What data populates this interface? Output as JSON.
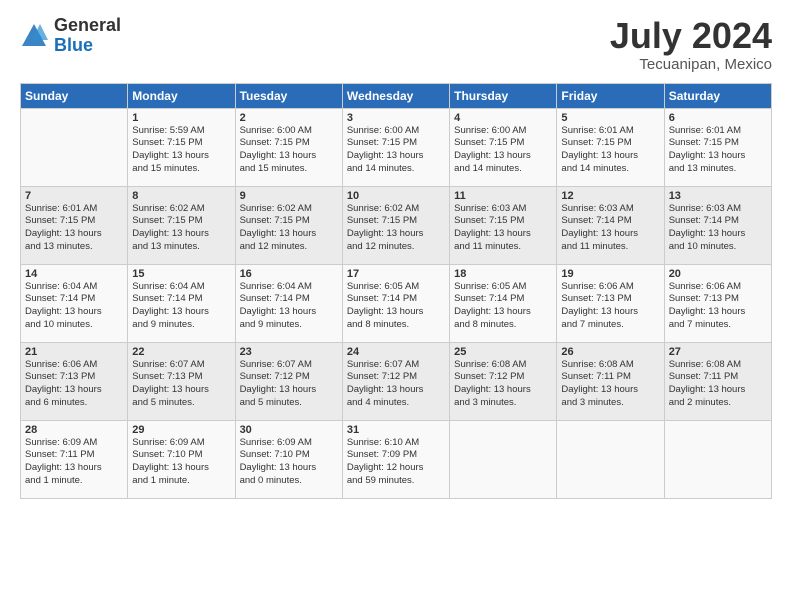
{
  "logo": {
    "general": "General",
    "blue": "Blue"
  },
  "title": "July 2024",
  "location": "Tecuanipan, Mexico",
  "days_of_week": [
    "Sunday",
    "Monday",
    "Tuesday",
    "Wednesday",
    "Thursday",
    "Friday",
    "Saturday"
  ],
  "weeks": [
    [
      {
        "day": "",
        "info": ""
      },
      {
        "day": "1",
        "info": "Sunrise: 5:59 AM\nSunset: 7:15 PM\nDaylight: 13 hours\nand 15 minutes."
      },
      {
        "day": "2",
        "info": "Sunrise: 6:00 AM\nSunset: 7:15 PM\nDaylight: 13 hours\nand 15 minutes."
      },
      {
        "day": "3",
        "info": "Sunrise: 6:00 AM\nSunset: 7:15 PM\nDaylight: 13 hours\nand 14 minutes."
      },
      {
        "day": "4",
        "info": "Sunrise: 6:00 AM\nSunset: 7:15 PM\nDaylight: 13 hours\nand 14 minutes."
      },
      {
        "day": "5",
        "info": "Sunrise: 6:01 AM\nSunset: 7:15 PM\nDaylight: 13 hours\nand 14 minutes."
      },
      {
        "day": "6",
        "info": "Sunrise: 6:01 AM\nSunset: 7:15 PM\nDaylight: 13 hours\nand 13 minutes."
      }
    ],
    [
      {
        "day": "7",
        "info": "Sunrise: 6:01 AM\nSunset: 7:15 PM\nDaylight: 13 hours\nand 13 minutes."
      },
      {
        "day": "8",
        "info": "Sunrise: 6:02 AM\nSunset: 7:15 PM\nDaylight: 13 hours\nand 13 minutes."
      },
      {
        "day": "9",
        "info": "Sunrise: 6:02 AM\nSunset: 7:15 PM\nDaylight: 13 hours\nand 12 minutes."
      },
      {
        "day": "10",
        "info": "Sunrise: 6:02 AM\nSunset: 7:15 PM\nDaylight: 13 hours\nand 12 minutes."
      },
      {
        "day": "11",
        "info": "Sunrise: 6:03 AM\nSunset: 7:15 PM\nDaylight: 13 hours\nand 11 minutes."
      },
      {
        "day": "12",
        "info": "Sunrise: 6:03 AM\nSunset: 7:14 PM\nDaylight: 13 hours\nand 11 minutes."
      },
      {
        "day": "13",
        "info": "Sunrise: 6:03 AM\nSunset: 7:14 PM\nDaylight: 13 hours\nand 10 minutes."
      }
    ],
    [
      {
        "day": "14",
        "info": "Sunrise: 6:04 AM\nSunset: 7:14 PM\nDaylight: 13 hours\nand 10 minutes."
      },
      {
        "day": "15",
        "info": "Sunrise: 6:04 AM\nSunset: 7:14 PM\nDaylight: 13 hours\nand 9 minutes."
      },
      {
        "day": "16",
        "info": "Sunrise: 6:04 AM\nSunset: 7:14 PM\nDaylight: 13 hours\nand 9 minutes."
      },
      {
        "day": "17",
        "info": "Sunrise: 6:05 AM\nSunset: 7:14 PM\nDaylight: 13 hours\nand 8 minutes."
      },
      {
        "day": "18",
        "info": "Sunrise: 6:05 AM\nSunset: 7:14 PM\nDaylight: 13 hours\nand 8 minutes."
      },
      {
        "day": "19",
        "info": "Sunrise: 6:06 AM\nSunset: 7:13 PM\nDaylight: 13 hours\nand 7 minutes."
      },
      {
        "day": "20",
        "info": "Sunrise: 6:06 AM\nSunset: 7:13 PM\nDaylight: 13 hours\nand 7 minutes."
      }
    ],
    [
      {
        "day": "21",
        "info": "Sunrise: 6:06 AM\nSunset: 7:13 PM\nDaylight: 13 hours\nand 6 minutes."
      },
      {
        "day": "22",
        "info": "Sunrise: 6:07 AM\nSunset: 7:13 PM\nDaylight: 13 hours\nand 5 minutes."
      },
      {
        "day": "23",
        "info": "Sunrise: 6:07 AM\nSunset: 7:12 PM\nDaylight: 13 hours\nand 5 minutes."
      },
      {
        "day": "24",
        "info": "Sunrise: 6:07 AM\nSunset: 7:12 PM\nDaylight: 13 hours\nand 4 minutes."
      },
      {
        "day": "25",
        "info": "Sunrise: 6:08 AM\nSunset: 7:12 PM\nDaylight: 13 hours\nand 3 minutes."
      },
      {
        "day": "26",
        "info": "Sunrise: 6:08 AM\nSunset: 7:11 PM\nDaylight: 13 hours\nand 3 minutes."
      },
      {
        "day": "27",
        "info": "Sunrise: 6:08 AM\nSunset: 7:11 PM\nDaylight: 13 hours\nand 2 minutes."
      }
    ],
    [
      {
        "day": "28",
        "info": "Sunrise: 6:09 AM\nSunset: 7:11 PM\nDaylight: 13 hours\nand 1 minute."
      },
      {
        "day": "29",
        "info": "Sunrise: 6:09 AM\nSunset: 7:10 PM\nDaylight: 13 hours\nand 1 minute."
      },
      {
        "day": "30",
        "info": "Sunrise: 6:09 AM\nSunset: 7:10 PM\nDaylight: 13 hours\nand 0 minutes."
      },
      {
        "day": "31",
        "info": "Sunrise: 6:10 AM\nSunset: 7:09 PM\nDaylight: 12 hours\nand 59 minutes."
      },
      {
        "day": "",
        "info": ""
      },
      {
        "day": "",
        "info": ""
      },
      {
        "day": "",
        "info": ""
      }
    ]
  ]
}
